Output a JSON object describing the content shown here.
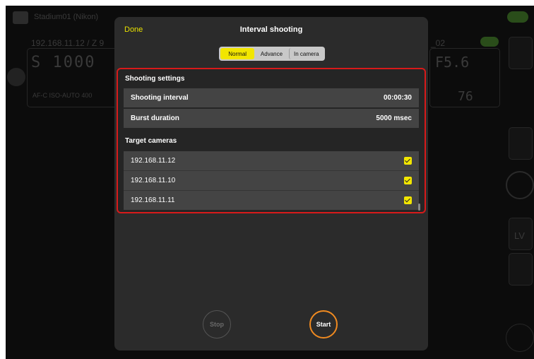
{
  "background": {
    "camera_name": "Stadium01 (Nikon)",
    "left_camera": {
      "title": "192.168.11.12 / Z 9",
      "shutter": "S  1000",
      "iso": "AF-C  ISO-AUTO 400"
    },
    "right_camera": {
      "title": "_02",
      "fstop": "F5.6",
      "count": "76"
    },
    "lv_label": "LV"
  },
  "dialog": {
    "done_label": "Done",
    "title": "Interval shooting",
    "tabs": [
      {
        "label": "Normal",
        "active": true
      },
      {
        "label": "Advance",
        "active": false
      },
      {
        "label": "In camera",
        "active": false
      }
    ],
    "shooting_settings": {
      "header": "Shooting settings",
      "interval_label": "Shooting interval",
      "interval_value": "00:00:30",
      "burst_label": "Burst duration",
      "burst_value": "5000 msec"
    },
    "target_cameras": {
      "header": "Target cameras",
      "items": [
        {
          "ip": "192.168.11.12",
          "checked": true
        },
        {
          "ip": "192.168.11.10",
          "checked": true
        },
        {
          "ip": "192.168.11.11",
          "checked": true
        }
      ]
    },
    "stop_label": "Stop",
    "start_label": "Start"
  },
  "colors": {
    "accent_yellow": "#f2e600",
    "start_ring": "#f08a20",
    "highlight_border": "#d81a1a"
  }
}
